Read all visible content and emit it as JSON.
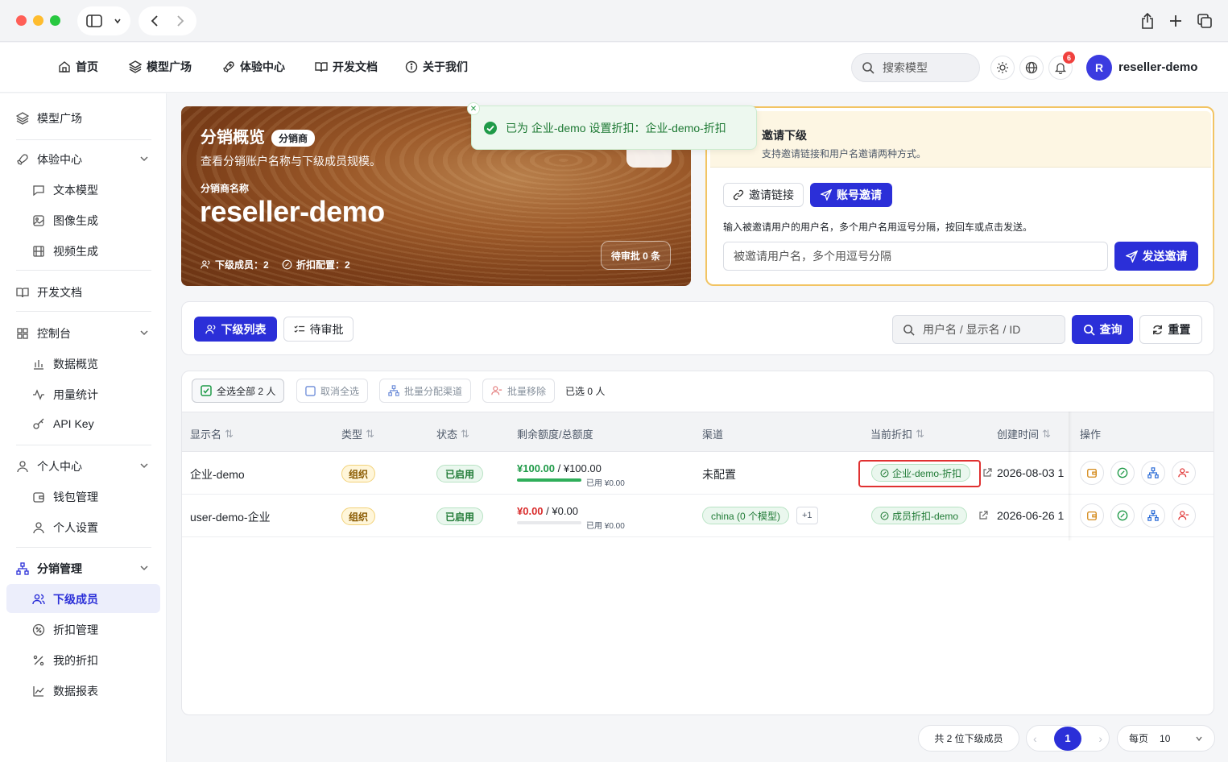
{
  "header": {
    "nav": [
      "首页",
      "模型广场",
      "体验中心",
      "开发文档",
      "关于我们"
    ],
    "search_placeholder": "搜索模型",
    "notification_count": "6",
    "avatar_letter": "R",
    "username": "reseller-demo"
  },
  "sidebar": {
    "model_square": "模型广场",
    "experience": "体验中心",
    "text_model": "文本模型",
    "image_gen": "图像生成",
    "video_gen": "视频生成",
    "dev_docs": "开发文档",
    "console": "控制台",
    "data_overview": "数据概览",
    "usage_stats": "用量统计",
    "api_key": "API Key",
    "personal": "个人中心",
    "wallet": "钱包管理",
    "settings": "个人设置",
    "distribution": "分销管理",
    "sub_members": "下级成员",
    "discount_mgmt": "折扣管理",
    "my_discount": "我的折扣",
    "reports": "数据报表"
  },
  "hero": {
    "title": "分销概览",
    "badge": "分销商",
    "subtitle": "查看分销账户名称与下级成员规模。",
    "name_label": "分销商名称",
    "name": "reseller-demo",
    "members": "下级成员：2",
    "discounts": "折扣配置：2",
    "pending": "待审批 0 条"
  },
  "toast": {
    "message": "已为 企业-demo 设置折扣：企业-demo-折扣"
  },
  "invite": {
    "title": "邀请下级",
    "desc": "支持邀请链接和用户名邀请两种方式。",
    "tab_link": "邀请链接",
    "tab_account": "账号邀请",
    "instruction": "输入被邀请用户的用户名，多个用户名用逗号分隔，按回车或点击发送。",
    "input_placeholder": "被邀请用户名，多个用逗号分隔",
    "send": "发送邀请"
  },
  "tabs": {
    "list": "下级列表",
    "pending": "待审批",
    "search_placeholder": "用户名 / 显示名 / ID",
    "query": "查询",
    "reset": "重置"
  },
  "toolbar": {
    "select_all": "全选全部 2 人",
    "deselect": "取消全选",
    "assign_channel": "批量分配渠道",
    "remove": "批量移除",
    "selected": "已选 0 人"
  },
  "table": {
    "headers": [
      "显示名",
      "类型",
      "状态",
      "剩余额度/总额度",
      "渠道",
      "当前折扣",
      "创建时间",
      "操作"
    ],
    "rows": [
      {
        "name": "企业-demo",
        "type": "组织",
        "status": "已启用",
        "remain": "¥100.00",
        "total": "/ ¥100.00",
        "used": "已用 ¥0.00",
        "progress": 1.0,
        "channel": "未配置",
        "channel_extra": "",
        "discount": "企业-demo-折扣",
        "created": "2026-08-03 1"
      },
      {
        "name": "user-demo-企业",
        "type": "组织",
        "status": "已启用",
        "remain": "¥0.00",
        "total": "/ ¥0.00",
        "used": "已用 ¥0.00",
        "progress": 0,
        "channel": "china (0 个模型)",
        "channel_extra": "+1",
        "discount": "成员折扣-demo",
        "created": "2026-06-26 1"
      }
    ]
  },
  "footer": {
    "total": "共 2 位下级成员",
    "page": "1",
    "per_page_label": "每页",
    "per_page": "10"
  },
  "colors": {
    "primary": "#2b2fd8",
    "success": "#1f7a35",
    "danger": "#d92b2b",
    "highlight": "#e03131"
  }
}
